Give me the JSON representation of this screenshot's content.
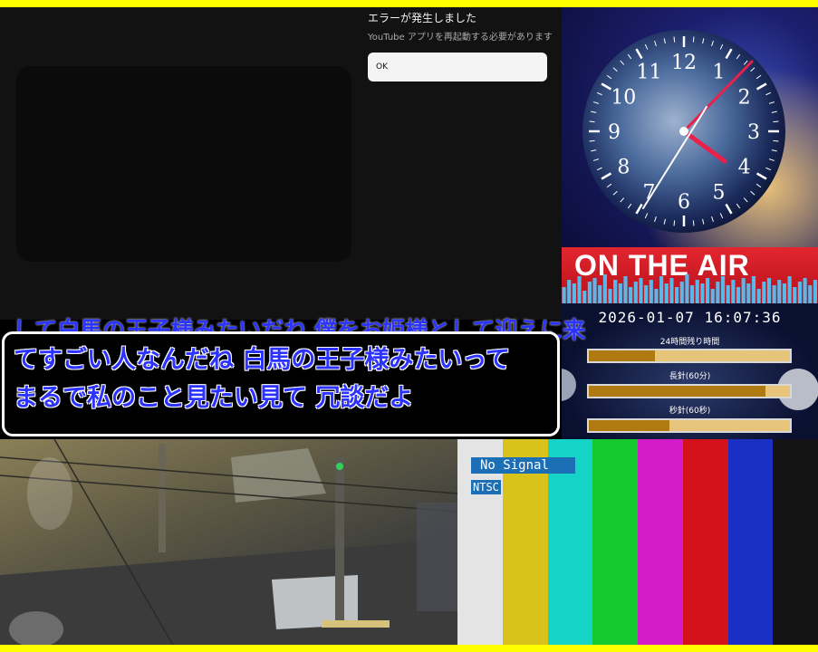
{
  "youtube": {
    "error_title": "エラーが発生しました",
    "error_message": "YouTube アプリを再起動する必要があります",
    "ok_label": "OK"
  },
  "clock": {
    "numerals": [
      "12",
      "1",
      "2",
      "3",
      "4",
      "5",
      "6",
      "7",
      "8",
      "9",
      "10",
      "11"
    ],
    "colors": {
      "minute_hand": "#e8204a",
      "hour_hand": "#e8204a",
      "second_hand": "#ffffff"
    }
  },
  "on_air": {
    "text": "ON THE AIR",
    "color": "#e3262f"
  },
  "countdown": {
    "datetime": "2026-01-07 16:07:36",
    "day_label": "24時間残り時間",
    "minute_label": "長針(60分)",
    "second_label": "秒針(60秒)",
    "day_progress": 0.33,
    "minute_progress": 0.88,
    "second_progress": 0.4
  },
  "subtitle": {
    "partial_line": "して白馬の王子様みたいだね 僕をお姫様として迎えに来",
    "line1": "てすごい人なんだね 白馬の王子様みたいって",
    "line2": "まるで私のこと見たい見て 冗談だよ"
  },
  "camera": {
    "description_color": "#8a7f57"
  },
  "test_pattern": {
    "no_signal": "No Signal",
    "standard": "NTSC",
    "bars": [
      "#e4e4e4",
      "#d8c21b",
      "#15d3c6",
      "#13c92e",
      "#d41bc8",
      "#d4121c",
      "#1a2fc4",
      "#141414"
    ]
  }
}
